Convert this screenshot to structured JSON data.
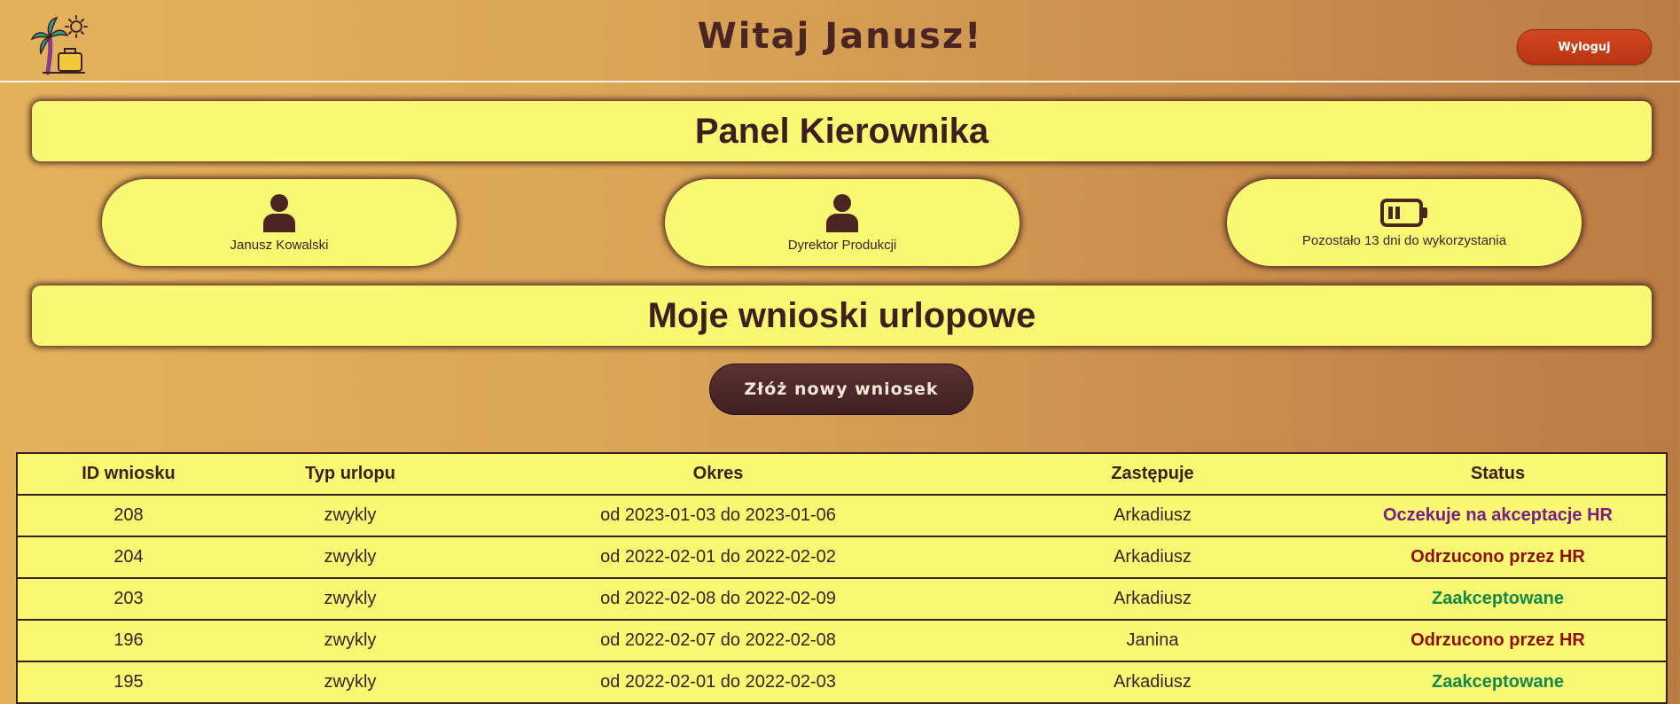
{
  "header": {
    "welcome": "Witaj Janusz!",
    "logout_label": "Wyloguj",
    "logo_icon": "palm-suitcase-sun-icon"
  },
  "panel": {
    "title": "Panel Kierownika"
  },
  "cards": [
    {
      "icon": "user-icon",
      "text": "Janusz Kowalski"
    },
    {
      "icon": "user-icon",
      "text": "Dyrektor Produkcji"
    },
    {
      "icon": "battery-low-icon",
      "text": "Pozostało 13 dni do wykorzystania"
    }
  ],
  "requests": {
    "title": "Moje wnioski urlopowe",
    "new_button": "Złóż nowy wniosek",
    "columns": [
      "ID wniosku",
      "Typ urlopu",
      "Okres",
      "Zastępuje",
      "Status"
    ],
    "rows": [
      {
        "id": "208",
        "type": "zwykly",
        "period": "od 2023-01-03 do 2023-01-06",
        "replaces": "Arkadiusz",
        "status": "Oczekuje na akceptacje HR"
      },
      {
        "id": "204",
        "type": "zwykly",
        "period": "od 2022-02-01 do 2022-02-02",
        "replaces": "Arkadiusz",
        "status": "Odrzucono przez HR"
      },
      {
        "id": "203",
        "type": "zwykly",
        "period": "od 2022-02-08 do 2022-02-09",
        "replaces": "Arkadiusz",
        "status": "Zaakceptowane"
      },
      {
        "id": "196",
        "type": "zwykly",
        "period": "od 2022-02-07 do 2022-02-08",
        "replaces": "Janina",
        "status": "Odrzucono przez HR"
      },
      {
        "id": "195",
        "type": "zwykly",
        "period": "od 2022-02-01 do 2022-02-03",
        "replaces": "Arkadiusz",
        "status": "Zaakceptowane"
      }
    ]
  },
  "colors": {
    "pending": "#7a1d86",
    "rejected": "#8f1010",
    "accepted": "#14874a",
    "panel_bg": "#f8f872"
  }
}
